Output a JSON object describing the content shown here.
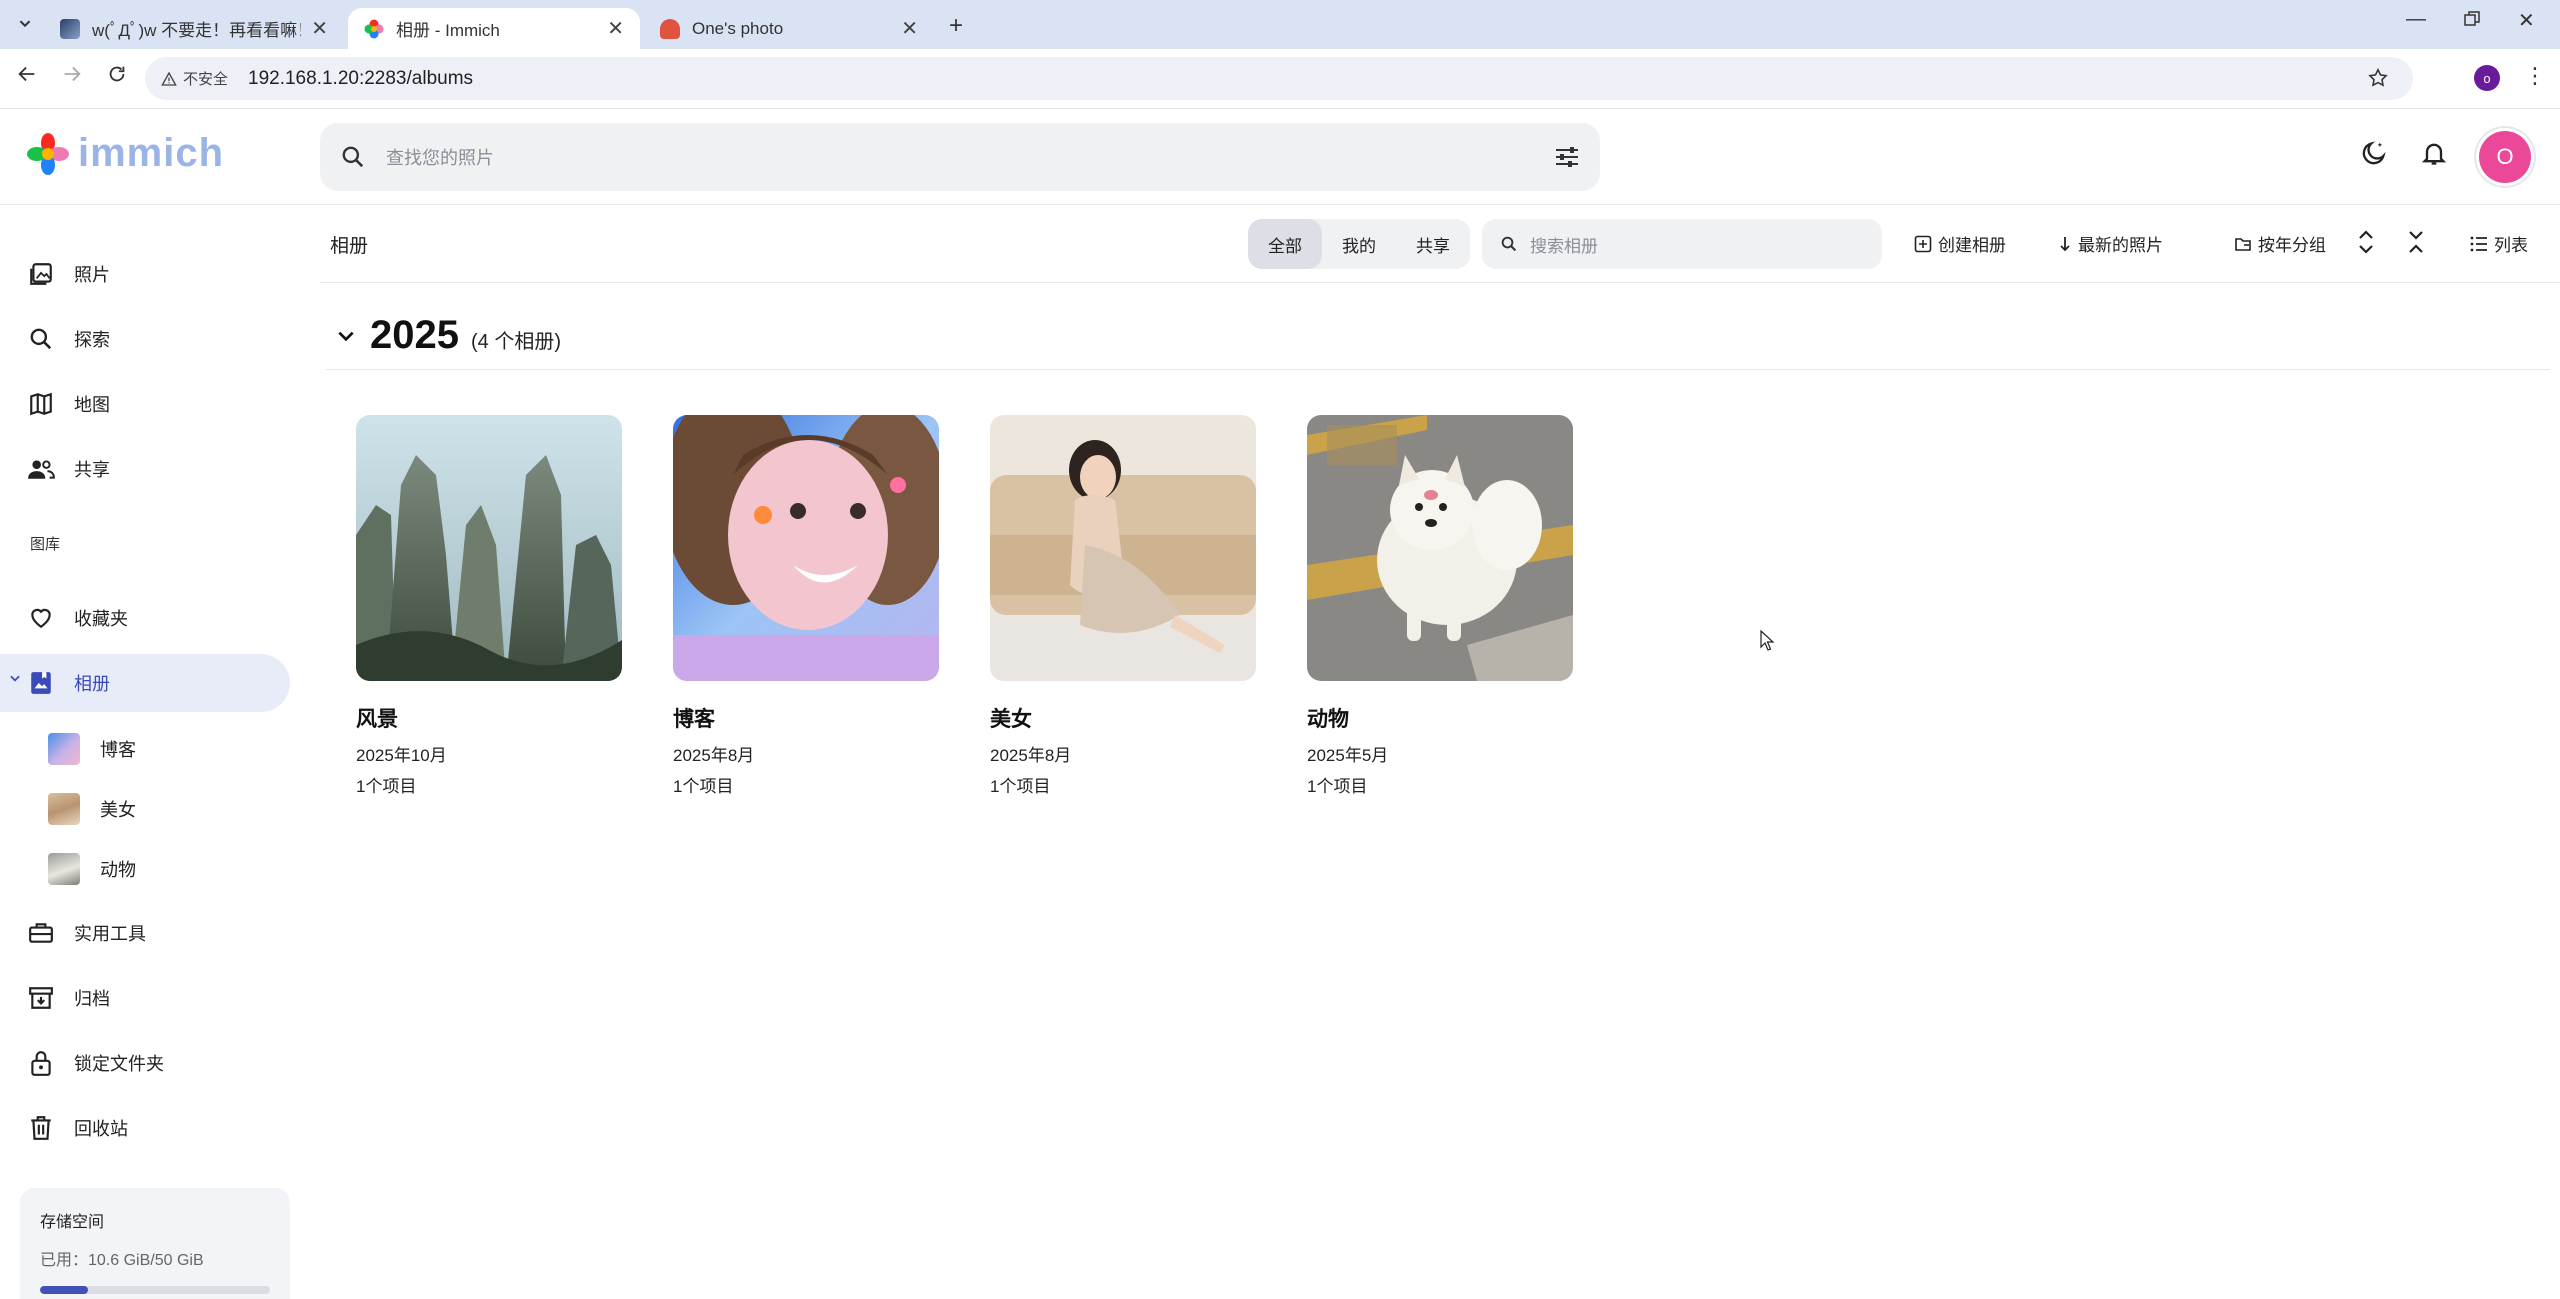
{
  "browser": {
    "tabs": [
      {
        "title": "w(ﾟДﾟ)w 不要走！再看看嘛！",
        "active": false
      },
      {
        "title": "相册 - Immich",
        "active": true
      },
      {
        "title": "One's photo",
        "active": false
      }
    ],
    "address": {
      "security_label": "不安全",
      "url": "192.168.1.20:2283/albums"
    },
    "profile_initial": "o"
  },
  "app": {
    "logo_text": "immich",
    "search_placeholder": "查找您的照片",
    "avatar_initial": "O"
  },
  "sidebar": {
    "items": [
      {
        "label": "照片",
        "icon": "photos-icon"
      },
      {
        "label": "探索",
        "icon": "search-icon"
      },
      {
        "label": "地图",
        "icon": "map-icon"
      },
      {
        "label": "共享",
        "icon": "people-icon"
      }
    ],
    "library_label": "图库",
    "library_items": [
      {
        "label": "收藏夹",
        "icon": "heart-icon"
      },
      {
        "label": "相册",
        "icon": "album-icon",
        "active": true
      }
    ],
    "albums": [
      {
        "label": "博客"
      },
      {
        "label": "美女"
      },
      {
        "label": "动物"
      }
    ],
    "tools_items": [
      {
        "label": "实用工具",
        "icon": "toolbox-icon"
      },
      {
        "label": "归档",
        "icon": "archive-icon"
      },
      {
        "label": "锁定文件夹",
        "icon": "lock-icon"
      },
      {
        "label": "回收站",
        "icon": "trash-icon"
      }
    ],
    "storage": {
      "title": "存储空间",
      "usage": "已用：10.6 GiB/50 GiB",
      "used_fraction": 0.21
    }
  },
  "toolbar": {
    "title": "相册",
    "filters": [
      "全部",
      "我的",
      "共享"
    ],
    "selected_filter": "全部",
    "album_search_placeholder": "搜索相册",
    "create_album": "创建相册",
    "sort": "最新的照片",
    "group": "按年分组",
    "view": "列表"
  },
  "content": {
    "year": "2025",
    "year_count": "(4 个相册)",
    "albums": [
      {
        "name": "风景",
        "date": "2025年10月",
        "count": "1个项目"
      },
      {
        "name": "博客",
        "date": "2025年8月",
        "count": "1个项目"
      },
      {
        "name": "美女",
        "date": "2025年8月",
        "count": "1个项目"
      },
      {
        "name": "动物",
        "date": "2025年5月",
        "count": "1个项目"
      }
    ]
  },
  "colors": {
    "accent": "#4251b8",
    "avatar": "#ec4899",
    "tabstrip": "#dae3f3"
  }
}
